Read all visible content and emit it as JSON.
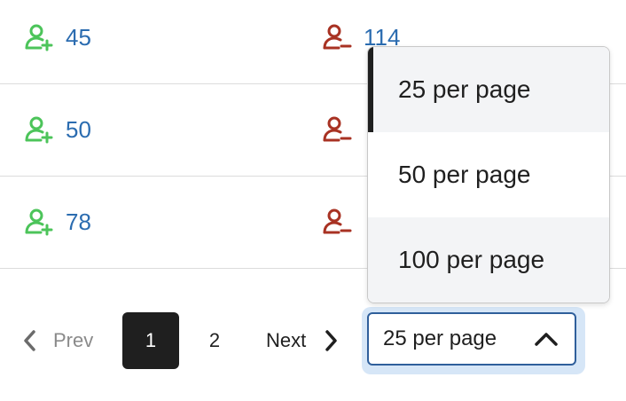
{
  "rows": [
    {
      "added": "45",
      "removed": "114"
    },
    {
      "added": "50",
      "removed": ""
    },
    {
      "added": "78",
      "removed": ""
    }
  ],
  "icons": {
    "added": "user-plus-icon",
    "removed": "user-minus-icon",
    "added_color": "#4cc45a",
    "removed_color": "#a83223"
  },
  "pagination": {
    "prev_label": "Prev",
    "pages": [
      "1",
      "2"
    ],
    "current_page": "1",
    "next_label": "Next"
  },
  "per_page": {
    "selected": "25 per page",
    "options": [
      "25 per page",
      "50 per page",
      "100 per page"
    ]
  }
}
